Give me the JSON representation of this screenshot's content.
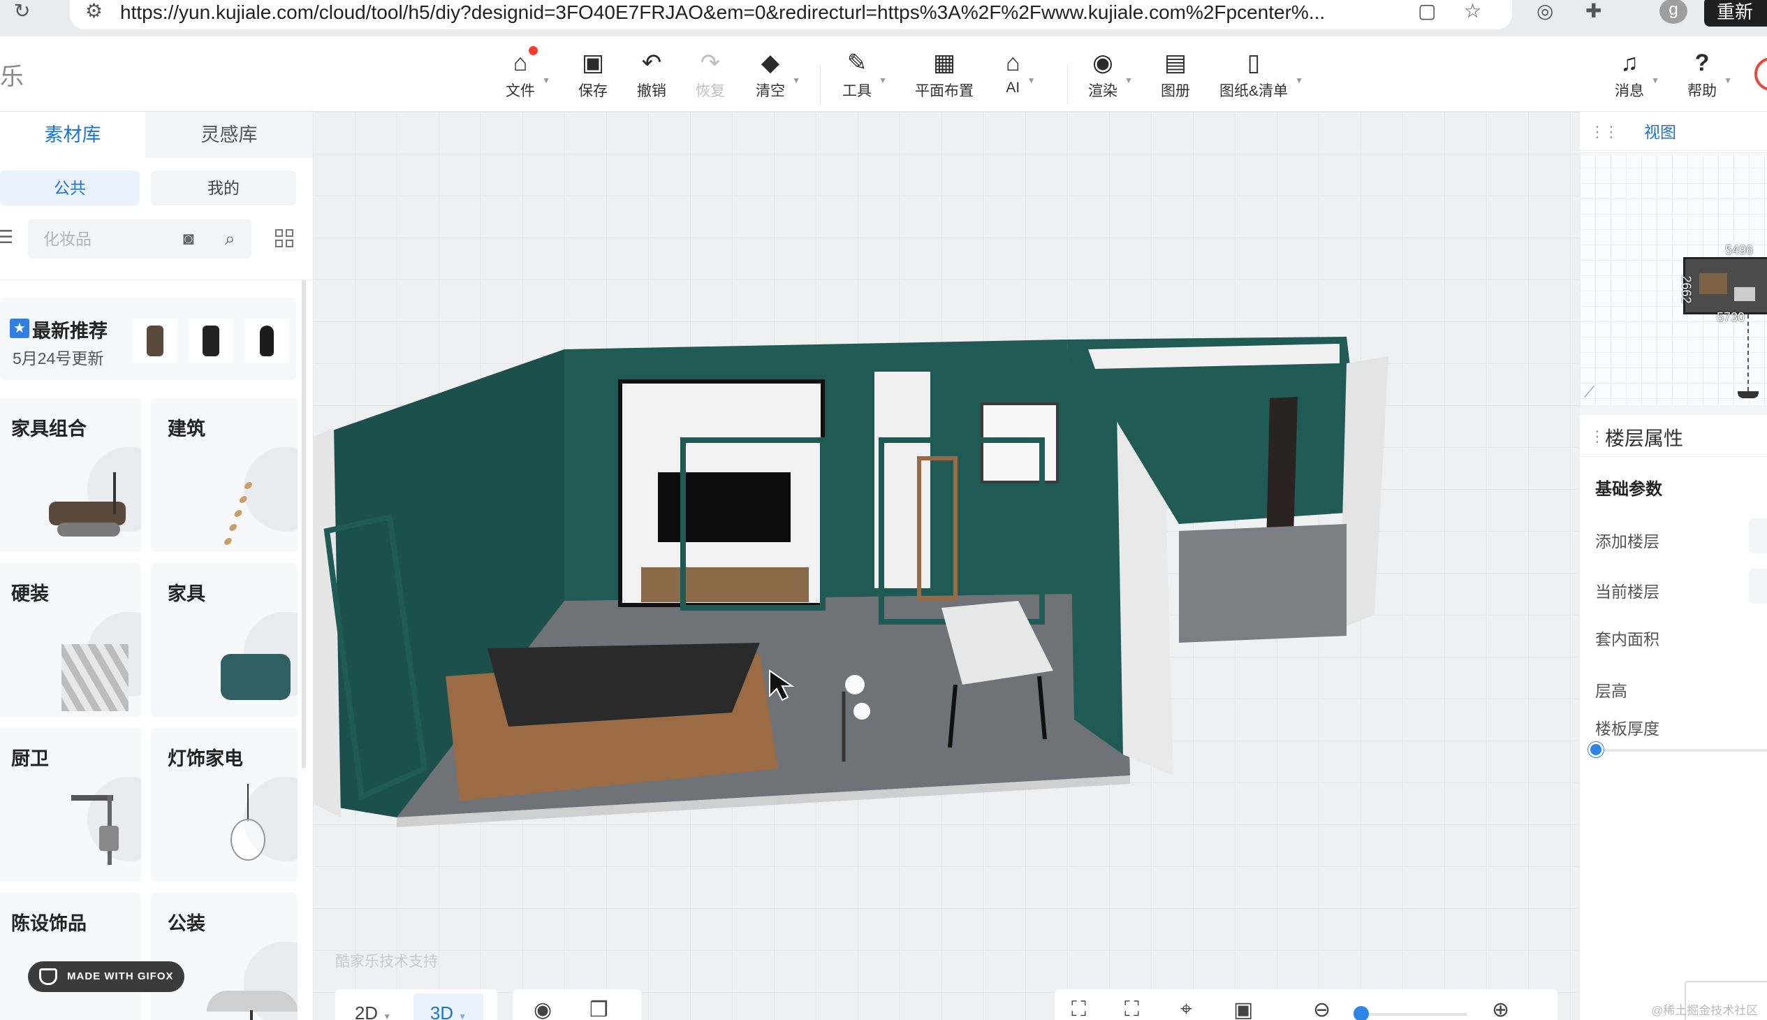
{
  "browser": {
    "url": "https://yun.kujiale.com/cloud/tool/h5/diy?designid=3FO40E7FRJAO&em=0&redirecturl=https%3A%2F%2Fwww.kujiale.com%2Fpcenter%...",
    "profile_initial": "g",
    "reload_label": "重新"
  },
  "app": {
    "logo_fragment": "乐"
  },
  "toolbar": [
    {
      "id": "file",
      "label": "文件",
      "icon": "house-icon",
      "glyph": "⌂",
      "has_badge": true,
      "has_caret": true
    },
    {
      "id": "save",
      "label": "保存",
      "icon": "save-icon",
      "glyph": "▣"
    },
    {
      "id": "undo",
      "label": "撤销",
      "icon": "undo-icon",
      "glyph": "↶"
    },
    {
      "id": "redo",
      "label": "恢复",
      "icon": "redo-icon",
      "glyph": "↷",
      "disabled": true
    },
    {
      "id": "clear",
      "label": "清空",
      "icon": "eraser-icon",
      "glyph": "◆",
      "has_caret": true
    },
    {
      "id": "tools",
      "label": "工具",
      "icon": "wrench-icon",
      "glyph": "✎",
      "has_caret": true
    },
    {
      "id": "floorplan",
      "label": "平面布置",
      "icon": "layout-icon",
      "glyph": "▦"
    },
    {
      "id": "ai",
      "label": "AI",
      "icon": "ai-house-icon",
      "glyph": "⌂",
      "has_caret": true
    },
    {
      "id": "render",
      "label": "渲染",
      "icon": "camera-icon",
      "glyph": "◉",
      "has_caret": true
    },
    {
      "id": "album",
      "label": "图册",
      "icon": "album-icon",
      "glyph": "▤"
    },
    {
      "id": "drawings",
      "label": "图纸&清单",
      "icon": "document-icon",
      "glyph": "▯",
      "has_caret": true
    },
    {
      "id": "messages",
      "label": "消息",
      "icon": "bell-icon",
      "glyph": "♫",
      "has_caret": true
    },
    {
      "id": "help",
      "label": "帮助",
      "icon": "help-icon",
      "glyph": "?",
      "has_caret": true
    }
  ],
  "left_panel": {
    "tabs": [
      "素材库",
      "灵感库"
    ],
    "scopes": [
      "公共",
      "我的"
    ],
    "search_placeholder": "化妆品",
    "recommend": {
      "title": "最新推荐",
      "subtitle": "5月24号更新"
    },
    "categories": [
      "家具组合",
      "建筑",
      "硬装",
      "家具",
      "厨卫",
      "灯饰家电",
      "陈设饰品",
      "公装"
    ]
  },
  "right_panel": {
    "view_title": "视图",
    "minimap": {
      "dim_top": "5496",
      "dim_bottom": "5730",
      "dim_side": "2662"
    },
    "floor": {
      "title": "楼层属性",
      "section": "基础参数",
      "rows": [
        "添加楼层",
        "当前楼层",
        "套内面积",
        "层高",
        "楼板厚度"
      ]
    }
  },
  "viewport": {
    "watermark": "酷家乐技术支持",
    "view_modes": [
      "2D",
      "3D"
    ],
    "active_mode": "3D"
  },
  "overlay": {
    "gifox": "MADE WITH GIFOX",
    "corner_note": "@稀土掘金技术社区"
  },
  "colors": {
    "accent": "#1a73d9",
    "wall_green": "#1f5a55",
    "floor_grey": "#6f7377"
  }
}
